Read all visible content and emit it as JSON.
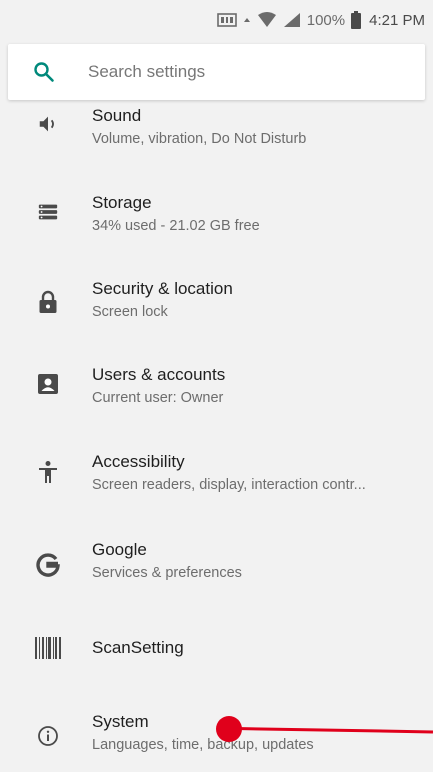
{
  "status_bar": {
    "battery": "100%",
    "time": "4:21 PM"
  },
  "search": {
    "placeholder": "Search settings"
  },
  "items": [
    {
      "title": "Sound",
      "summary": "Volume, vibration, Do Not Disturb",
      "icon": "volume-icon"
    },
    {
      "title": "Storage",
      "summary": "34% used - 21.02 GB free",
      "icon": "storage-icon"
    },
    {
      "title": "Security & location",
      "summary": "Screen lock",
      "icon": "lock-icon"
    },
    {
      "title": "Users & accounts",
      "summary": "Current user: Owner",
      "icon": "account-box-icon"
    },
    {
      "title": "Accessibility",
      "summary": "Screen readers, display, interaction contr...",
      "icon": "accessibility-icon"
    },
    {
      "title": "Google",
      "summary": "Services & preferences",
      "icon": "google-icon"
    },
    {
      "title": "ScanSetting",
      "summary": "",
      "icon": "barcode-icon"
    },
    {
      "title": "System",
      "summary": "Languages, time, backup, updates",
      "icon": "info-icon"
    }
  ],
  "colors": {
    "accent": "#00897b",
    "icon": "#4a4a4a",
    "annotation": "#e0001b"
  }
}
